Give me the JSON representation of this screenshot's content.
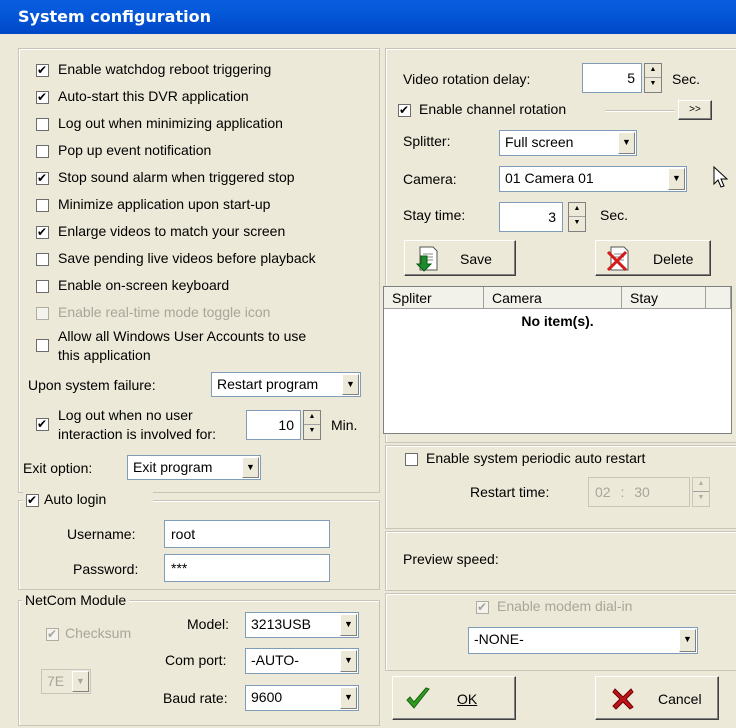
{
  "window": {
    "title": "System configuration"
  },
  "left": {
    "checkboxes": [
      {
        "label": "Enable watchdog reboot triggering",
        "checked": true
      },
      {
        "label": "Auto-start this DVR application",
        "checked": true
      },
      {
        "label": "Log out when minimizing application",
        "checked": false
      },
      {
        "label": "Pop up event notification",
        "checked": false
      },
      {
        "label": "Stop sound alarm when triggered stop",
        "checked": true
      },
      {
        "label": "Minimize application upon start-up",
        "checked": false
      },
      {
        "label": "Enlarge videos to match your screen",
        "checked": true
      },
      {
        "label": "Save pending live videos before playback",
        "checked": false
      },
      {
        "label": "Enable on-screen keyboard",
        "checked": false
      },
      {
        "label": "Enable real-time mode toggle icon",
        "checked": false,
        "disabled": true
      }
    ],
    "allow_accounts_line1": "Allow all Windows User Accounts to use",
    "allow_accounts_line2": "this application",
    "failure_label": "Upon system failure:",
    "failure_value": "Restart program",
    "logout_line1": "Log out when no user",
    "logout_line2": "interaction is involved for:",
    "logout_value": "10",
    "logout_unit": "Min.",
    "exit_label": "Exit option:",
    "exit_value": "Exit program"
  },
  "autologin": {
    "label": "Auto login",
    "username_label": "Username:",
    "username_value": "root",
    "password_label": "Password:",
    "password_value": "***"
  },
  "netcom": {
    "title": "NetCom Module",
    "checksum_label": "Checksum",
    "checksum_value": "7E",
    "model_label": "Model:",
    "model_value": "3213USB",
    "comport_label": "Com port:",
    "comport_value": "-AUTO-",
    "baud_label": "Baud rate:",
    "baud_value": "9600"
  },
  "rotation": {
    "delay_label": "Video rotation delay:",
    "delay_value": "5",
    "delay_unit": "Sec.",
    "enable_label": "Enable channel rotation",
    "expand_label": ">>",
    "splitter_label": "Splitter:",
    "splitter_value": "Full screen",
    "camera_label": "Camera:",
    "camera_value": "01 Camera 01",
    "stay_label": "Stay time:",
    "stay_value": "3",
    "stay_unit": "Sec.",
    "save_label": "Save",
    "delete_label": "Delete",
    "columns": [
      "Spliter",
      "Camera",
      "Stay"
    ],
    "empty_text": "No item(s)."
  },
  "restart": {
    "enable_label": "Enable system periodic auto restart",
    "time_label": "Restart time:",
    "time_hour": "02",
    "time_sep": ":",
    "time_min": "30"
  },
  "preview": {
    "label": "Preview speed:"
  },
  "modem": {
    "enable_label": "Enable modem dial-in",
    "value": "-NONE-"
  },
  "footer": {
    "ok_label": "OK",
    "cancel_label": "Cancel"
  }
}
